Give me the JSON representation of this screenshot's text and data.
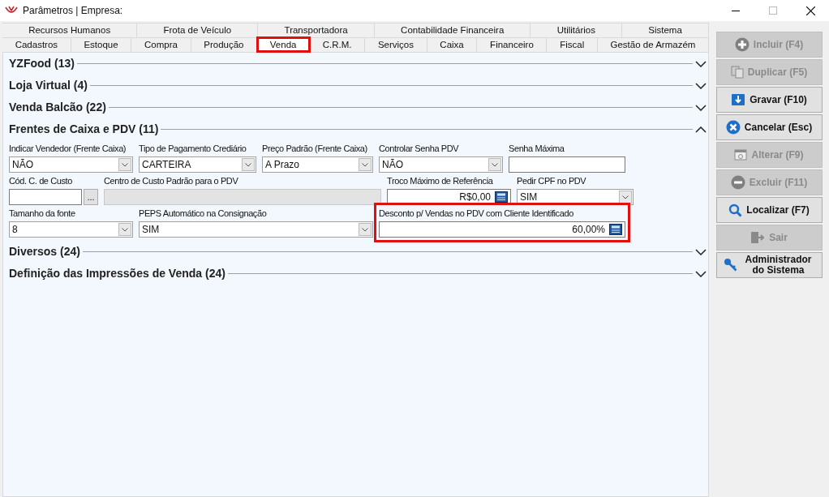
{
  "window": {
    "title": "Parâmetros | Empresa:"
  },
  "tab_rows": [
    [
      {
        "label": "Recursos Humanos",
        "selected": false,
        "highlighted": false
      },
      {
        "label": "Frota de Veículo",
        "selected": false,
        "highlighted": false
      },
      {
        "label": "Transportadora",
        "selected": false,
        "highlighted": false
      },
      {
        "label": "Contabilidade Financeira",
        "selected": false,
        "highlighted": false
      },
      {
        "label": "Utilitários",
        "selected": false,
        "highlighted": false
      },
      {
        "label": "Sistema",
        "selected": false,
        "highlighted": false
      }
    ],
    [
      {
        "label": "Cadastros",
        "selected": false,
        "highlighted": false
      },
      {
        "label": "Estoque",
        "selected": false,
        "highlighted": false
      },
      {
        "label": "Compra",
        "selected": false,
        "highlighted": false
      },
      {
        "label": "Produção",
        "selected": false,
        "highlighted": false
      },
      {
        "label": "Venda",
        "selected": true,
        "highlighted": true
      },
      {
        "label": "C.R.M.",
        "selected": false,
        "highlighted": false
      },
      {
        "label": "Serviços",
        "selected": false,
        "highlighted": false
      },
      {
        "label": "Caixa",
        "selected": false,
        "highlighted": false
      },
      {
        "label": "Financeiro",
        "selected": false,
        "highlighted": false
      },
      {
        "label": "Fiscal",
        "selected": false,
        "highlighted": false
      },
      {
        "label": "Gestão de Armazém",
        "selected": false,
        "highlighted": false
      }
    ]
  ],
  "sections": [
    {
      "title": "YZFood (13)",
      "expanded": false
    },
    {
      "title": "Loja Virtual (4)",
      "expanded": false
    },
    {
      "title": "Venda Balcão (22)",
      "expanded": false
    },
    {
      "title": "Frentes de Caixa e PDV (11)",
      "expanded": true,
      "field_rows": [
        [
          {
            "kind": "select",
            "label": "Indicar Vendedor (Frente Caixa)",
            "value": "NÃO",
            "highlighted": false
          },
          {
            "kind": "select",
            "label": "Tipo de Pagamento Crediário",
            "value": "CARTEIRA",
            "highlighted": false
          },
          {
            "kind": "select",
            "label": "Preço Padrão (Frente Caixa)",
            "value": "A Prazo",
            "highlighted": false
          },
          {
            "kind": "select",
            "label": "Controlar Senha PDV",
            "value": "NÃO",
            "highlighted": false
          },
          {
            "kind": "text",
            "label": "Senha Máxima",
            "highlighted": false
          }
        ],
        [
          {
            "kind": "lookup",
            "label": "Cód. C. de Custo",
            "button": "...",
            "highlighted": false
          },
          {
            "kind": "disabled",
            "label": "Centro de Custo Padrão para o PDV",
            "highlighted": false
          },
          {
            "kind": "currency",
            "label": "Troco Máximo de Referência",
            "value": "R$0,00",
            "highlighted": false
          },
          {
            "kind": "select",
            "label": "Pedir CPF no PDV",
            "value": "SIM",
            "highlighted": false
          }
        ],
        [
          {
            "kind": "select",
            "label": "Tamanho da fonte",
            "value": "8",
            "highlighted": false
          },
          {
            "kind": "select",
            "label": "PEPS Automático na Consignação",
            "value": "SIM",
            "highlighted": false
          },
          {
            "kind": "currency",
            "label": "Desconto p/ Vendas no PDV com Cliente Identificado",
            "value": "60,00%",
            "highlighted": true
          }
        ]
      ]
    },
    {
      "title": "Diversos (24)",
      "expanded": false
    },
    {
      "title": "Definição das Impressões de Venda (24)",
      "expanded": false
    }
  ],
  "actions": [
    {
      "label": "Incluir (F4)",
      "kind": "plus",
      "enabled": false
    },
    {
      "label": "Duplicar (F5)",
      "kind": "copy",
      "enabled": false
    },
    {
      "label": "Gravar (F10)",
      "kind": "save",
      "enabled": true
    },
    {
      "label": "Cancelar (Esc)",
      "kind": "cancel",
      "enabled": true
    },
    {
      "label": "Alterar (F9)",
      "kind": "edit",
      "enabled": false
    },
    {
      "label": "Excluir (F11)",
      "kind": "minus",
      "enabled": false
    },
    {
      "label": "Localizar (F7)",
      "kind": "search",
      "enabled": true
    },
    {
      "label": "Sair",
      "kind": "exit",
      "enabled": false
    },
    {
      "label": "Administrador do Sistema",
      "kind": "key",
      "enabled": true
    }
  ]
}
